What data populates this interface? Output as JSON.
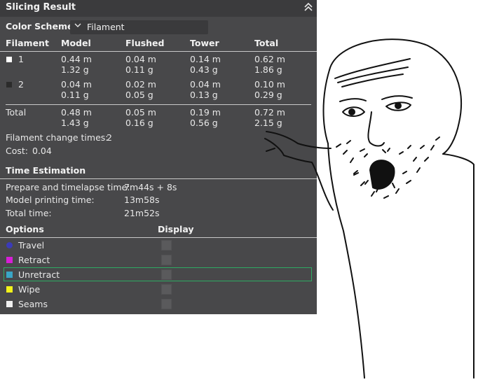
{
  "panel": {
    "title": "Slicing Result",
    "color_scheme_label": "Color Scheme",
    "color_scheme_value": "Filament",
    "headers": [
      "Filament",
      "Model",
      "Flushed",
      "Tower",
      "Total"
    ],
    "filaments": [
      {
        "id": "1",
        "swatch": "#ffffff",
        "model_m": "0.44 m",
        "model_g": "1.32 g",
        "flushed_m": "0.04 m",
        "flushed_g": "0.11 g",
        "tower_m": "0.14 m",
        "tower_g": "0.43 g",
        "total_m": "0.62 m",
        "total_g": "1.86 g"
      },
      {
        "id": "2",
        "swatch": "#2b2b2b",
        "model_m": "0.04 m",
        "model_g": "0.11 g",
        "flushed_m": "0.02 m",
        "flushed_g": "0.05 g",
        "tower_m": "0.04 m",
        "tower_g": "0.13 g",
        "total_m": "0.10 m",
        "total_g": "0.29 g"
      }
    ],
    "total": {
      "label": "Total",
      "model_m": "0.48 m",
      "model_g": "1.43 g",
      "flushed_m": "0.05 m",
      "flushed_g": "0.16 g",
      "tower_m": "0.19 m",
      "tower_g": "0.56 g",
      "total_m": "0.72 m",
      "total_g": "2.15 g"
    },
    "change_times_label": "Filament change times:",
    "change_times_value": "2",
    "cost_label": "Cost:",
    "cost_value": "0.04",
    "time_estimation_title": "Time Estimation",
    "times": [
      {
        "label": "Prepare and timelapse time:",
        "value": "7m44s + 8s"
      },
      {
        "label": "Model printing time:",
        "value": "13m58s"
      },
      {
        "label": "Total time:",
        "value": "21m52s"
      }
    ],
    "options_header": "Options",
    "display_header": "Display",
    "options": [
      {
        "label": "Travel",
        "color": "#3b3bb8",
        "shape": "dot"
      },
      {
        "label": "Retract",
        "color": "#d61fd6",
        "shape": "square"
      },
      {
        "label": "Unretract",
        "color": "#3aa6c6",
        "shape": "square"
      },
      {
        "label": "Wipe",
        "color": "#f2f21a",
        "shape": "square"
      },
      {
        "label": "Seams",
        "color": "#f0f0f0",
        "shape": "square"
      }
    ]
  },
  "accent_color": "#2eab63",
  "meme_icon": "pointing-wojak-drawing"
}
